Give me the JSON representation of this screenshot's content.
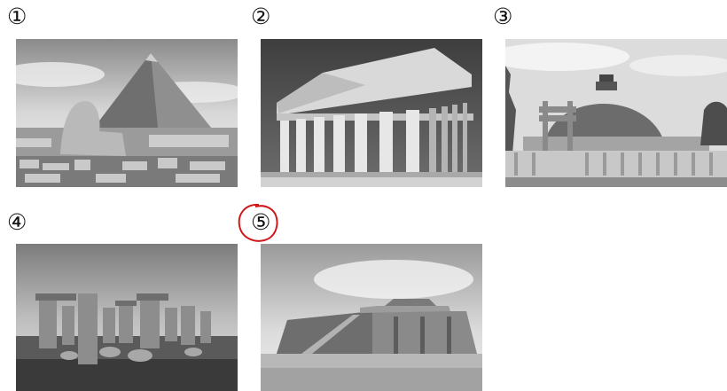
{
  "labels": [
    "①",
    "②",
    "③",
    "④",
    "⑤"
  ],
  "photos": [
    {
      "icon": "pyramid-sphinx-photo"
    },
    {
      "icon": "parthenon-photo"
    },
    {
      "icon": "stupa-photo"
    },
    {
      "icon": "stonehenge-photo"
    },
    {
      "icon": "ziggurat-photo"
    }
  ],
  "highlight": {
    "label_index": 4,
    "color": "#d0181a"
  }
}
